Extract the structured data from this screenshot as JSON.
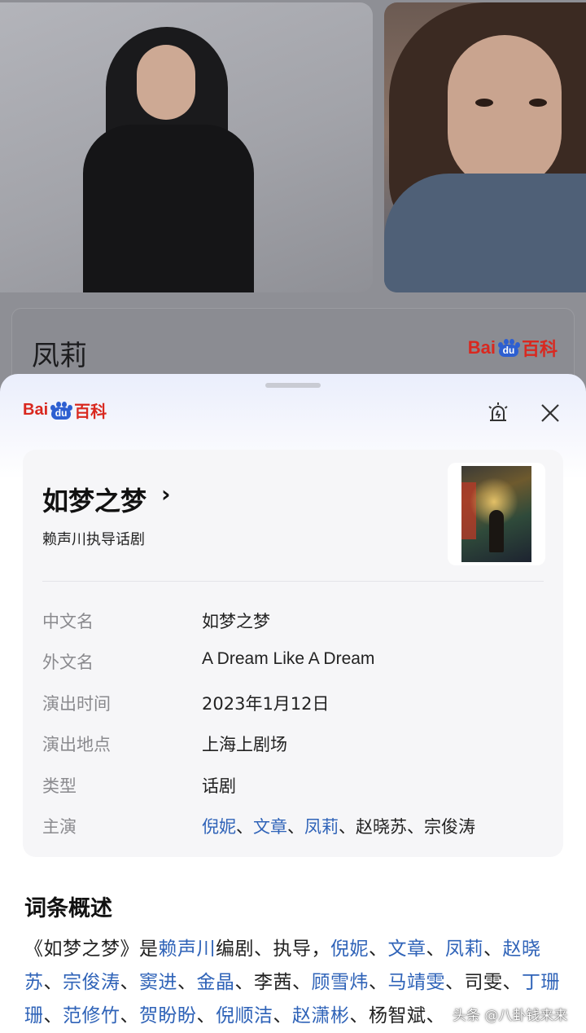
{
  "background": {
    "card_title": "凤莉",
    "logo": {
      "bai": "Bai",
      "du": "du",
      "baike": "百科"
    }
  },
  "sheet": {
    "logo": {
      "bai": "Bai",
      "du": "du",
      "baike": "百科"
    },
    "icons": {
      "report": "report-alarm-icon",
      "close": "close-icon"
    }
  },
  "entry": {
    "title": "如梦之梦",
    "chevron": "›",
    "subtitle": "赖声川执导话剧",
    "poster_icon": "poster-image"
  },
  "info": {
    "rows": [
      {
        "key": "中文名",
        "value": "如梦之梦"
      },
      {
        "key": "外文名",
        "value": "A Dream Like A Dream"
      },
      {
        "key": "演出时间",
        "value": "2023年1月12日"
      },
      {
        "key": "演出地点",
        "value": "上海上剧场"
      },
      {
        "key": "类型",
        "value": "话剧"
      },
      {
        "key": "主演",
        "cast": [
          "倪妮",
          "文章",
          "凤莉",
          "赵晓苏",
          "宗俊涛"
        ],
        "cast_linked": [
          true,
          true,
          true,
          false,
          false
        ],
        "separator": "、"
      }
    ]
  },
  "summary": {
    "title": "词条概述",
    "segments": [
      {
        "t": "《如梦之梦》是",
        "link": false
      },
      {
        "t": "赖声川",
        "link": true
      },
      {
        "t": "编剧、执导，",
        "link": false
      },
      {
        "t": "倪妮",
        "link": true
      },
      {
        "t": "、",
        "link": false
      },
      {
        "t": "文章",
        "link": true
      },
      {
        "t": "、",
        "link": false
      },
      {
        "t": "凤莉",
        "link": true
      },
      {
        "t": "、",
        "link": false
      },
      {
        "t": "赵晓苏",
        "link": true
      },
      {
        "t": "、",
        "link": false
      },
      {
        "t": "宗俊涛",
        "link": true
      },
      {
        "t": "、",
        "link": false
      },
      {
        "t": "窦进",
        "link": true
      },
      {
        "t": "、",
        "link": false
      },
      {
        "t": "金晶",
        "link": true
      },
      {
        "t": "、李茜、",
        "link": false
      },
      {
        "t": "顾雪炜",
        "link": true
      },
      {
        "t": "、",
        "link": false
      },
      {
        "t": "马靖雯",
        "link": true
      },
      {
        "t": "、司雯、",
        "link": false
      },
      {
        "t": "丁珊珊",
        "link": true
      },
      {
        "t": "、",
        "link": false
      },
      {
        "t": "范修竹",
        "link": true
      },
      {
        "t": "、",
        "link": false
      },
      {
        "t": "贺盼盼",
        "link": true
      },
      {
        "t": "、",
        "link": false
      },
      {
        "t": "倪顺洁",
        "link": true
      },
      {
        "t": "、",
        "link": false
      },
      {
        "t": "赵潇彬",
        "link": true
      },
      {
        "t": "、杨智斌、",
        "link": false
      }
    ]
  },
  "watermark": "头条 @八卦钱来来",
  "colors": {
    "link": "#2f63b8",
    "baidu_red": "#d9281f",
    "baidu_blue": "#2d5fd1"
  }
}
